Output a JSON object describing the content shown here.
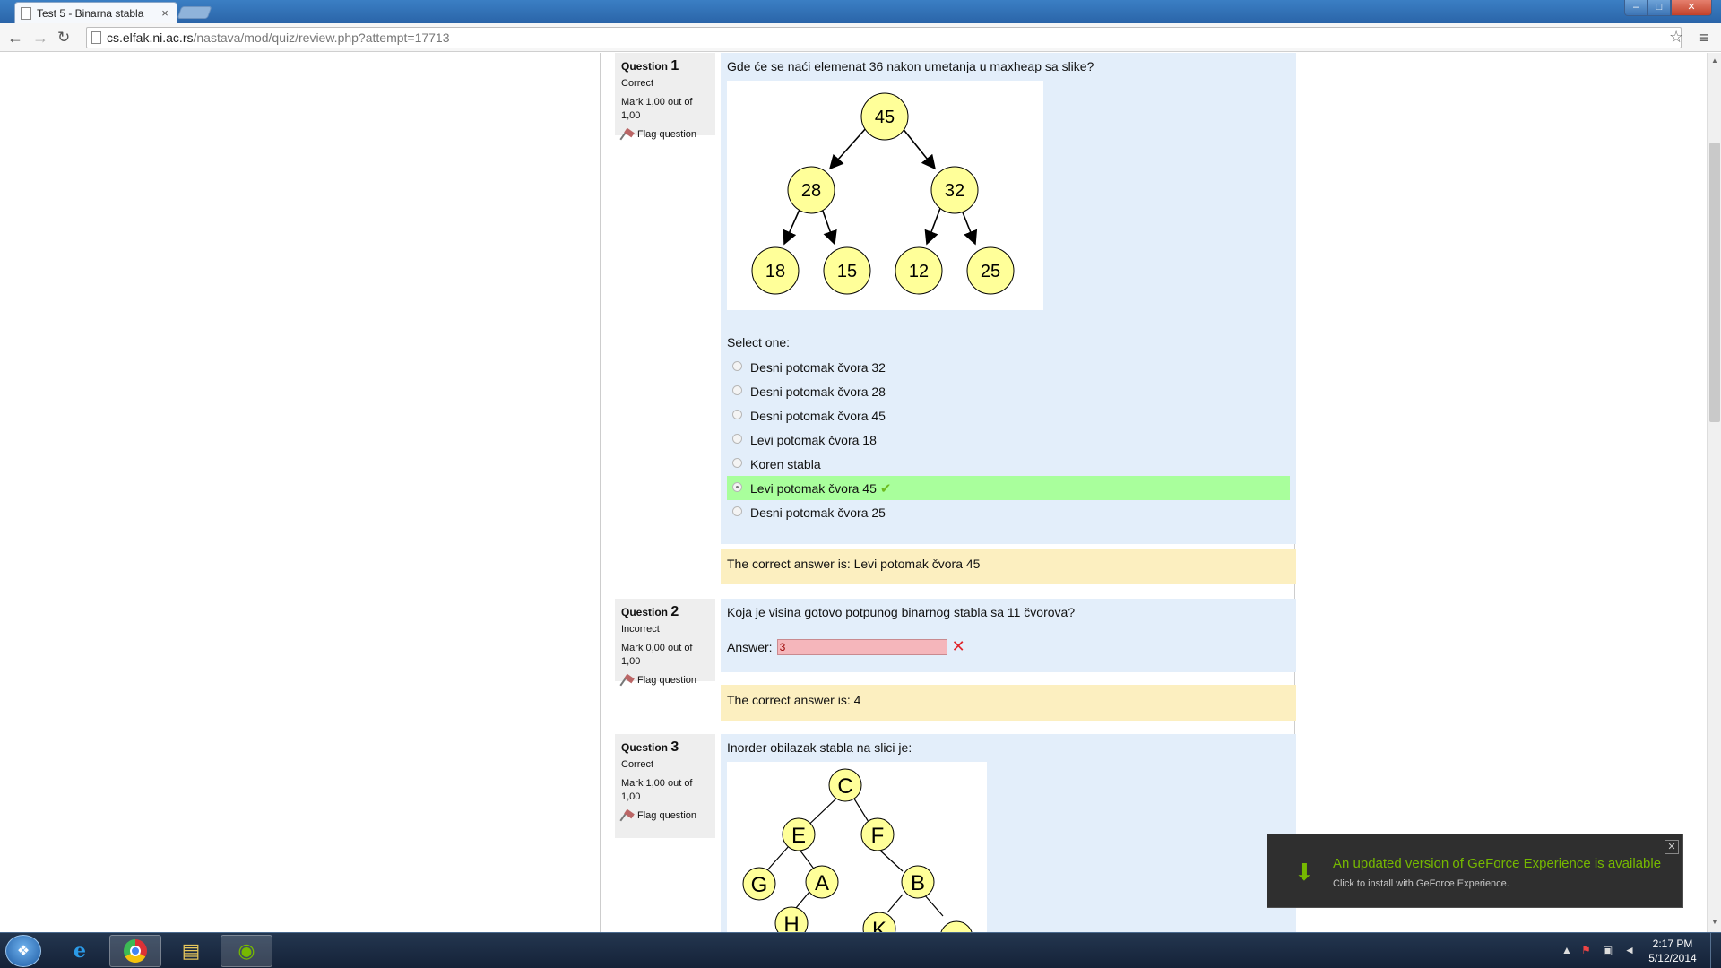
{
  "browser": {
    "tab_title": "Test 5 - Binarna stabla",
    "tab_close": "×",
    "url_host": "cs.elfak.ni.ac.rs",
    "url_path": "/nastava/mod/quiz/review.php?attempt=17713",
    "back": "←",
    "forward": "→",
    "reload": "↻",
    "star": "☆",
    "menu": "≡",
    "minimize": "–",
    "maximize": "□",
    "close": "✕"
  },
  "questions": [
    {
      "label": "Question",
      "number": "1",
      "state": "Correct",
      "mark": "Mark 1,00 out of 1,00",
      "flag": "Flag question",
      "text": "Gde će se naći elemenat 36 nakon umetanja u maxheap sa slike?",
      "tree_nodes": [
        "45",
        "28",
        "32",
        "18",
        "15",
        "12",
        "25"
      ],
      "select_label": "Select one:",
      "options": [
        {
          "label": "Desni potomak čvora 32",
          "checked": false,
          "correct": false
        },
        {
          "label": "Desni potomak čvora 28",
          "checked": false,
          "correct": false
        },
        {
          "label": "Desni potomak čvora 45",
          "checked": false,
          "correct": false
        },
        {
          "label": "Levi potomak čvora 18",
          "checked": false,
          "correct": false
        },
        {
          "label": "Koren stabla",
          "checked": false,
          "correct": false
        },
        {
          "label": "Levi potomak čvora 45",
          "checked": true,
          "correct": true
        },
        {
          "label": "Desni potomak čvora 25",
          "checked": false,
          "correct": false
        }
      ],
      "tick": "✔",
      "feedback": "The correct answer is: Levi potomak čvora 45"
    },
    {
      "label": "Question",
      "number": "2",
      "state": "Incorrect",
      "mark": "Mark 0,00 out of 1,00",
      "flag": "Flag question",
      "text": "Koja je visina gotovo potpunog binarnog stabla sa 11 čvorova?",
      "answer_label": "Answer:",
      "answer_value": "3",
      "cross": "✕",
      "feedback": "The correct answer is: 4"
    },
    {
      "label": "Question",
      "number": "3",
      "state": "Correct",
      "mark": "Mark 1,00 out of 1,00",
      "flag": "Flag question",
      "text": "Inorder obilazak stabla na slici je:",
      "tree_nodes": [
        "C",
        "E",
        "F",
        "G",
        "A",
        "B",
        "H",
        "K",
        ""
      ]
    }
  ],
  "notification": {
    "title": "An updated version of GeForce Experience is available",
    "subtitle": "Click to install with GeForce Experience.",
    "close": "✕"
  },
  "taskbar": {
    "time": "2:17 PM",
    "date": "5/12/2014"
  },
  "colors": {
    "question_bg": "#e3eefa",
    "feedback_bg": "#fcefc0",
    "correct_bg": "#a9ff9c",
    "incorrect_input": "#f5b6bb",
    "node_fill": "#ffff99"
  }
}
